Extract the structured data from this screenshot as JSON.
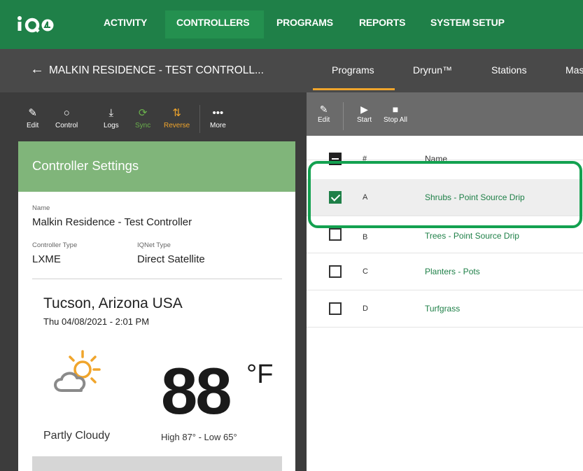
{
  "app": {
    "logo_text": "iQ4",
    "nav": [
      "ACTIVITY",
      "CONTROLLERS",
      "PROGRAMS",
      "REPORTS",
      "SYSTEM SETUP"
    ],
    "active_nav": "CONTROLLERS",
    "brand_color": "#1f8048"
  },
  "subheader": {
    "back_icon": "arrow-left-icon",
    "title": "MALKIN RESIDENCE - TEST CONTROLL...",
    "tabs": [
      "Programs",
      "Dryrun™",
      "Stations",
      "Mas"
    ],
    "active_tab": "Programs"
  },
  "left_toolbar": {
    "buttons": [
      {
        "label": "Edit",
        "icon": "pencil-icon"
      },
      {
        "label": "Control",
        "icon": "circle-icon"
      },
      {
        "label": "Logs",
        "icon": "download-icon"
      },
      {
        "label": "Sync",
        "icon": "sync-icon"
      },
      {
        "label": "Reverse",
        "icon": "reverse-icon"
      },
      {
        "label": "More",
        "icon": "more-icon"
      }
    ]
  },
  "settings": {
    "heading": "Controller Settings",
    "name_label": "Name",
    "name_value": "Malkin Residence - Test Controller",
    "type_label": "Controller Type",
    "type_value": "LXME",
    "iqnet_label": "IQNet Type",
    "iqnet_value": "Direct Satellite"
  },
  "weather": {
    "location": "Tucson, Arizona USA",
    "datetime": "Thu 04/08/2021 - 2:01 PM",
    "icon": "partly-cloudy-icon",
    "temperature": "88",
    "unit": "°F",
    "condition": "Partly Cloudy",
    "high_low": "High 87° - Low 65°"
  },
  "right_toolbar": {
    "edit": {
      "label": "Edit",
      "icon": "pencil-icon"
    },
    "start": {
      "label": "Start",
      "icon": "play-icon"
    },
    "stop_all": {
      "label": "Stop All",
      "icon": "stop-icon"
    }
  },
  "programs_table": {
    "columns": [
      "#",
      "Name"
    ],
    "rows": [
      {
        "id": "A",
        "name": "Shrubs - Point Source Drip",
        "checked": true
      },
      {
        "id": "B",
        "name": "Trees - Point Source Drip",
        "checked": false
      },
      {
        "id": "C",
        "name": "Planters - Pots",
        "checked": false
      },
      {
        "id": "D",
        "name": "Turfgrass",
        "checked": false
      }
    ]
  }
}
